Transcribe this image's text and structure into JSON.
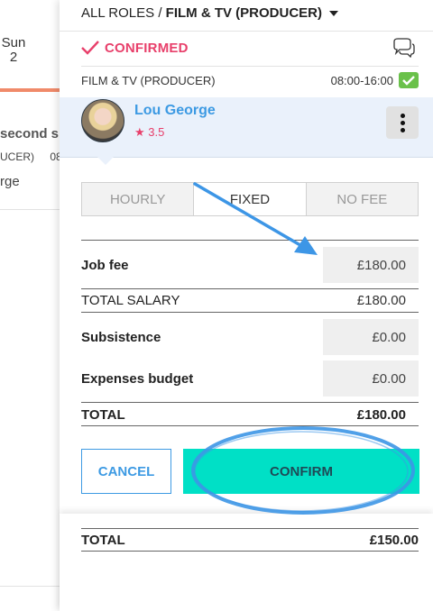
{
  "background_calendar": {
    "day_name": "Sun",
    "day_number": "2",
    "shift_title": "second sh",
    "shift_role": "UCER)",
    "shift_time": "08",
    "person_fragment": "rge"
  },
  "header": {
    "breadcrumb_all": "ALL ROLES /",
    "breadcrumb_current": "FILM & TV (PRODUCER)"
  },
  "status": {
    "label": "CONFIRMED",
    "color": "#e8406b"
  },
  "role": {
    "name": "FILM & TV (PRODUCER)",
    "time": "08:00-16:00"
  },
  "person": {
    "name": "Lou George",
    "rating": "3.5"
  },
  "tabs": [
    {
      "label": "HOURLY",
      "active": false
    },
    {
      "label": "FIXED",
      "active": true
    },
    {
      "label": "NO FEE",
      "active": false
    }
  ],
  "fees": {
    "job_fee_label": "Job fee",
    "job_fee_value": "£180.00",
    "total_salary_label": "TOTAL SALARY",
    "total_salary_value": "£180.00",
    "subsistence_label": "Subsistence",
    "subsistence_value": "£0.00",
    "expenses_label": "Expenses budget",
    "expenses_value": "£0.00",
    "total_label": "TOTAL",
    "total_value": "£180.00"
  },
  "actions": {
    "cancel_label": "CANCEL",
    "confirm_label": "CONFIRM"
  },
  "footer": {
    "total_label": "TOTAL",
    "total_value": "£150.00"
  },
  "colors": {
    "accent_blue": "#3d9ae3",
    "confirm_teal": "#00e0c6",
    "check_green": "#6ac14a",
    "annotation_blue": "#3d96e6"
  }
}
